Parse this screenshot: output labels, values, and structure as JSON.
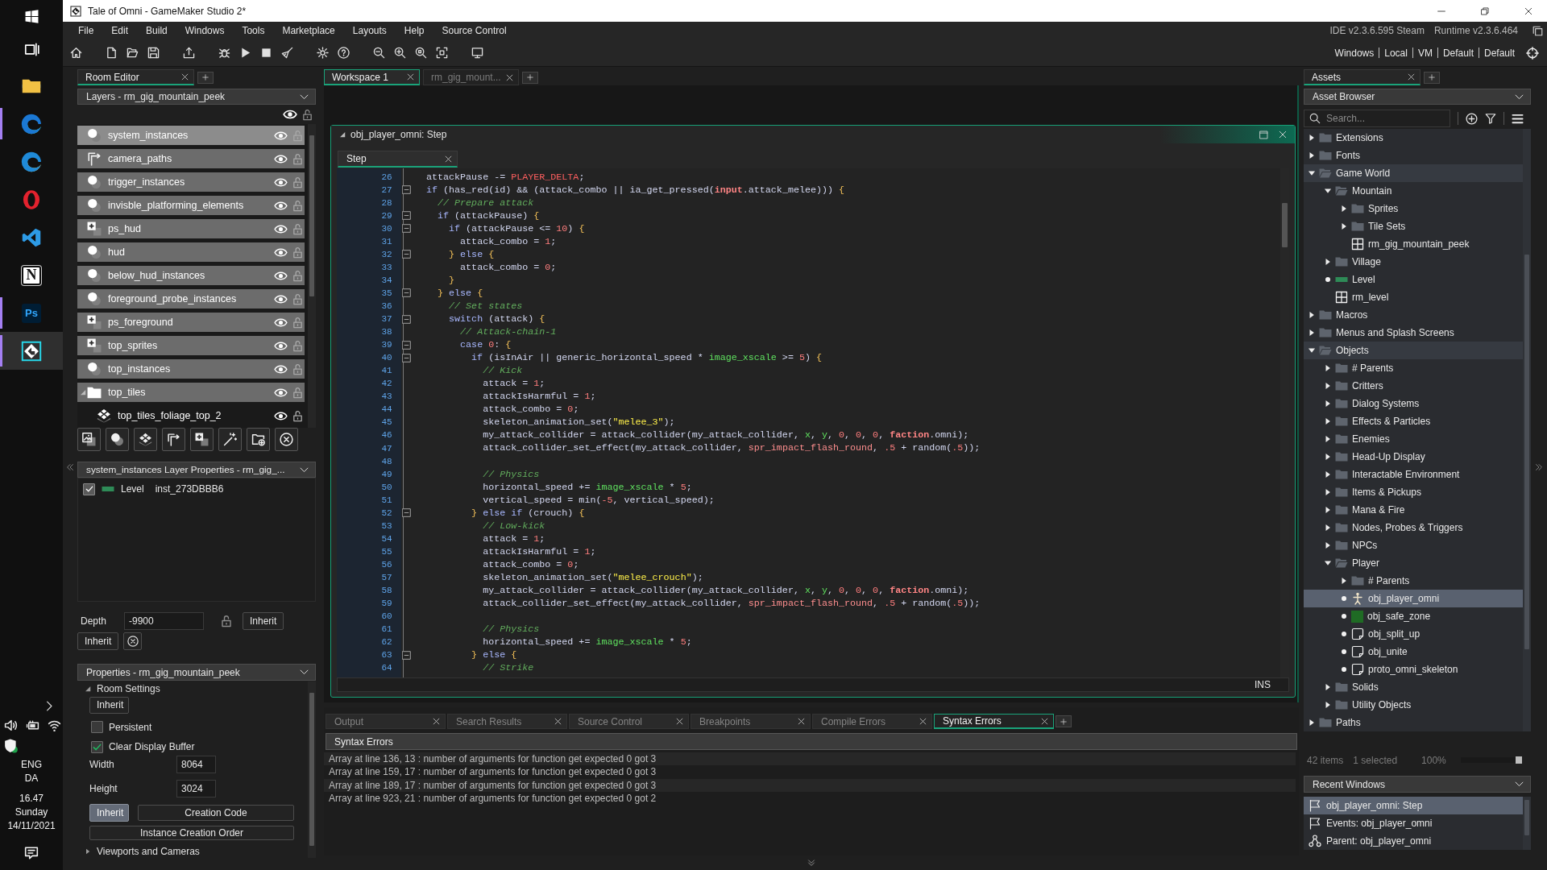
{
  "taskbar": {
    "apps": [
      {
        "kind": "start",
        "running": false,
        "selected": false
      },
      {
        "kind": "task_view",
        "running": false,
        "selected": false
      },
      {
        "kind": "files",
        "running": false,
        "selected": false
      },
      {
        "kind": "browser",
        "running": true,
        "selected": false
      },
      {
        "kind": "browser_beta",
        "running": false,
        "selected": false
      },
      {
        "kind": "ring",
        "running": false,
        "selected": false
      },
      {
        "kind": "editor",
        "running": false,
        "selected": false
      },
      {
        "kind": "notes",
        "label": "N",
        "running": false,
        "selected": false
      },
      {
        "kind": "ps",
        "label": "Ps",
        "running": true,
        "selected": false
      },
      {
        "kind": "gm",
        "running": true,
        "selected": true
      }
    ],
    "tray": {
      "language": [
        "ENG",
        "DA"
      ],
      "time": "16.47",
      "day": "Sunday",
      "date": "14/11/2021"
    }
  },
  "window": {
    "title": "Tale of Omni - GameMaker Studio 2*"
  },
  "menu": {
    "items": [
      "File",
      "Edit",
      "Build",
      "Windows",
      "Tools",
      "Marketplace",
      "Layouts",
      "Help",
      "Source Control"
    ],
    "ide": "IDE v2.3.6.595 Steam",
    "runtime": "Runtime v2.3.6.464"
  },
  "toolbar": {
    "targets": [
      "Windows",
      "Local",
      "VM",
      "Default",
      "Default"
    ]
  },
  "room_editor": {
    "tab": "Room Editor",
    "layers_title": "Layers - rm_gig_mountain_peek",
    "layers": [
      {
        "name": "system_instances",
        "kind": "instance",
        "selected": true
      },
      {
        "name": "camera_paths",
        "kind": "path",
        "selected": false
      },
      {
        "name": "trigger_instances",
        "kind": "instance",
        "selected": false
      },
      {
        "name": "invisble_platforming_elements",
        "kind": "instance",
        "selected": false
      },
      {
        "name": "ps_hud",
        "kind": "asset",
        "selected": false
      },
      {
        "name": "hud",
        "kind": "instance",
        "selected": false
      },
      {
        "name": "below_hud_instances",
        "kind": "instance",
        "selected": false
      },
      {
        "name": "foreground_probe_instances",
        "kind": "instance",
        "selected": false
      },
      {
        "name": "ps_foreground",
        "kind": "asset",
        "selected": false
      },
      {
        "name": "top_sprites",
        "kind": "asset",
        "selected": false
      },
      {
        "name": "top_instances",
        "kind": "instance",
        "selected": false
      },
      {
        "name": "top_tiles",
        "kind": "folder",
        "selected": false,
        "expanded": true,
        "children": [
          {
            "name": "top_tiles_foliage_top_2",
            "kind": "tile",
            "selected": false
          }
        ]
      }
    ],
    "layer_properties": {
      "title": "system_instances Layer Properties - rm_gig_...",
      "instances": [
        {
          "object": "Level",
          "id": "inst_273DBBB6",
          "checked": true
        }
      ],
      "depth": {
        "label": "Depth",
        "value": "-9900",
        "button": "Inherit"
      },
      "inherit_button": "Inherit"
    },
    "properties": {
      "title": "Properties - rm_gig_mountain_peek",
      "room_settings": {
        "label": "Room Settings",
        "expanded": true,
        "inherit_button": "Inherit",
        "options": [
          {
            "label": "Persistent",
            "checked": false
          },
          {
            "label": "Clear Display Buffer",
            "checked": true
          }
        ],
        "fields": [
          {
            "label": "Width",
            "value": "8064"
          },
          {
            "label": "Height",
            "value": "3024"
          }
        ],
        "buttons": [
          {
            "label": "Inherit",
            "selected": true
          },
          {
            "label": "Creation Code",
            "selected": false
          }
        ],
        "order_button": "Instance Creation Order"
      },
      "viewports": {
        "label": "Viewports and Cameras",
        "expanded": false
      }
    }
  },
  "workspace": {
    "tabs": [
      {
        "label": "Workspace 1",
        "selected": true
      },
      {
        "label": "rm_gig_mount...",
        "selected": false
      }
    ],
    "code_window": {
      "title": "obj_player_omni: Step",
      "tab": "Step",
      "mode": "INS",
      "lines": [
        {
          "number": "26",
          "fold": false,
          "tokens": [
            {
              "text": "attackPause -= ",
              "kind": "plain"
            },
            {
              "text": "PLAYER_DELTA",
              "kind": "macro"
            },
            {
              "text": ";",
              "kind": "plain"
            }
          ]
        },
        {
          "number": "27",
          "fold": true,
          "tokens": [
            {
              "text": "if",
              "kind": "keyword"
            },
            {
              "text": " (has_red(id) && (attack_combo || ia_get_pressed(",
              "kind": "plain"
            },
            {
              "text": "input",
              "kind": "enum"
            },
            {
              "text": ".attack_melee))) ",
              "kind": "plain"
            },
            {
              "text": "{",
              "kind": "brace"
            }
          ]
        },
        {
          "number": "28",
          "fold": false,
          "tokens": [
            {
              "text": "  // Prepare attack",
              "kind": "comment"
            }
          ]
        },
        {
          "number": "29",
          "fold": true,
          "tokens": [
            {
              "text": "  if",
              "kind": "keyword"
            },
            {
              "text": " (attackPause) ",
              "kind": "plain"
            },
            {
              "text": "{",
              "kind": "brace"
            }
          ]
        },
        {
          "number": "30",
          "fold": true,
          "tokens": [
            {
              "text": "    if",
              "kind": "keyword"
            },
            {
              "text": " (attackPause <= ",
              "kind": "plain"
            },
            {
              "text": "10",
              "kind": "number"
            },
            {
              "text": ") ",
              "kind": "plain"
            },
            {
              "text": "{",
              "kind": "brace"
            }
          ]
        },
        {
          "number": "31",
          "fold": false,
          "tokens": [
            {
              "text": "      attack_combo = ",
              "kind": "plain"
            },
            {
              "text": "1",
              "kind": "number"
            },
            {
              "text": ";",
              "kind": "plain"
            }
          ]
        },
        {
          "number": "32",
          "fold": true,
          "tokens": [
            {
              "text": "    }",
              "kind": "brace"
            },
            {
              "text": " else",
              "kind": "keyword"
            },
            {
              "text": " {",
              "kind": "brace"
            }
          ]
        },
        {
          "number": "33",
          "fold": false,
          "tokens": [
            {
              "text": "      attack_combo = ",
              "kind": "plain"
            },
            {
              "text": "0",
              "kind": "number"
            },
            {
              "text": ";",
              "kind": "plain"
            }
          ]
        },
        {
          "number": "34",
          "fold": false,
          "tokens": [
            {
              "text": "    }",
              "kind": "brace"
            }
          ]
        },
        {
          "number": "35",
          "fold": true,
          "tokens": [
            {
              "text": "  }",
              "kind": "brace"
            },
            {
              "text": " else",
              "kind": "keyword"
            },
            {
              "text": " {",
              "kind": "brace"
            }
          ]
        },
        {
          "number": "36",
          "fold": false,
          "tokens": [
            {
              "text": "    // Set states",
              "kind": "comment"
            }
          ]
        },
        {
          "number": "37",
          "fold": true,
          "tokens": [
            {
              "text": "    switch",
              "kind": "keyword"
            },
            {
              "text": " (attack) ",
              "kind": "plain"
            },
            {
              "text": "{",
              "kind": "brace"
            }
          ]
        },
        {
          "number": "38",
          "fold": false,
          "tokens": [
            {
              "text": "      // Attack-chain-1",
              "kind": "comment"
            }
          ]
        },
        {
          "number": "39",
          "fold": true,
          "tokens": [
            {
              "text": "      case",
              "kind": "keyword"
            },
            {
              "text": " 0",
              "kind": "number"
            },
            {
              "text": ": ",
              "kind": "plain"
            },
            {
              "text": "{",
              "kind": "brace"
            }
          ]
        },
        {
          "number": "40",
          "fold": true,
          "tokens": [
            {
              "text": "        if",
              "kind": "keyword"
            },
            {
              "text": " (isInAir || generic_horizontal_speed * ",
              "kind": "plain"
            },
            {
              "text": "image_xscale",
              "kind": "builtin"
            },
            {
              "text": " >= ",
              "kind": "plain"
            },
            {
              "text": "5",
              "kind": "number"
            },
            {
              "text": ") ",
              "kind": "plain"
            },
            {
              "text": "{",
              "kind": "brace"
            }
          ]
        },
        {
          "number": "41",
          "fold": false,
          "tokens": [
            {
              "text": "          // Kick",
              "kind": "comment"
            }
          ]
        },
        {
          "number": "42",
          "fold": false,
          "tokens": [
            {
              "text": "          attack = ",
              "kind": "plain"
            },
            {
              "text": "1",
              "kind": "number"
            },
            {
              "text": ";",
              "kind": "plain"
            }
          ]
        },
        {
          "number": "43",
          "fold": false,
          "tokens": [
            {
              "text": "          attackIsHarmful = ",
              "kind": "plain"
            },
            {
              "text": "1",
              "kind": "number"
            },
            {
              "text": ";",
              "kind": "plain"
            }
          ]
        },
        {
          "number": "44",
          "fold": false,
          "tokens": [
            {
              "text": "          attack_combo = ",
              "kind": "plain"
            },
            {
              "text": "0",
              "kind": "number"
            },
            {
              "text": ";",
              "kind": "plain"
            }
          ]
        },
        {
          "number": "45",
          "fold": false,
          "tokens": [
            {
              "text": "          skeleton_animation_set(",
              "kind": "plain"
            },
            {
              "text": "\"melee_3\"",
              "kind": "string"
            },
            {
              "text": ");",
              "kind": "plain"
            }
          ]
        },
        {
          "number": "46",
          "fold": false,
          "tokens": [
            {
              "text": "          my_attack_collider = attack_collider(my_attack_collider, ",
              "kind": "plain"
            },
            {
              "text": "x",
              "kind": "builtin"
            },
            {
              "text": ", ",
              "kind": "plain"
            },
            {
              "text": "y",
              "kind": "builtin"
            },
            {
              "text": ", ",
              "kind": "plain"
            },
            {
              "text": "0",
              "kind": "number"
            },
            {
              "text": ", ",
              "kind": "plain"
            },
            {
              "text": "0",
              "kind": "number"
            },
            {
              "text": ", ",
              "kind": "plain"
            },
            {
              "text": "0",
              "kind": "number"
            },
            {
              "text": ", ",
              "kind": "plain"
            },
            {
              "text": "faction",
              "kind": "enum"
            },
            {
              "text": ".omni);",
              "kind": "plain"
            }
          ]
        },
        {
          "number": "47",
          "fold": false,
          "tokens": [
            {
              "text": "          attack_collider_set_effect(my_attack_collider, ",
              "kind": "plain"
            },
            {
              "text": "spr_impact_flash_round",
              "kind": "asset"
            },
            {
              "text": ", ",
              "kind": "plain"
            },
            {
              "text": ".5",
              "kind": "number"
            },
            {
              "text": " + random(",
              "kind": "plain"
            },
            {
              "text": ".5",
              "kind": "number"
            },
            {
              "text": "));",
              "kind": "plain"
            }
          ]
        },
        {
          "number": "48",
          "fold": false
        },
        {
          "number": "49",
          "fold": false,
          "tokens": [
            {
              "text": "          // Physics",
              "kind": "comment"
            }
          ]
        },
        {
          "number": "50",
          "fold": false,
          "tokens": [
            {
              "text": "          horizontal_speed += ",
              "kind": "plain"
            },
            {
              "text": "image_xscale",
              "kind": "builtin"
            },
            {
              "text": " * ",
              "kind": "plain"
            },
            {
              "text": "5",
              "kind": "number"
            },
            {
              "text": ";",
              "kind": "plain"
            }
          ]
        },
        {
          "number": "51",
          "fold": false,
          "tokens": [
            {
              "text": "          vertical_speed = min(",
              "kind": "plain"
            },
            {
              "text": "-5",
              "kind": "number"
            },
            {
              "text": ", vertical_speed);",
              "kind": "plain"
            }
          ]
        },
        {
          "number": "52",
          "fold": true,
          "tokens": [
            {
              "text": "        }",
              "kind": "brace"
            },
            {
              "text": " else if",
              "kind": "keyword"
            },
            {
              "text": " (crouch) ",
              "kind": "plain"
            },
            {
              "text": "{",
              "kind": "brace"
            }
          ]
        },
        {
          "number": "53",
          "fold": false,
          "tokens": [
            {
              "text": "          // Low-kick",
              "kind": "comment"
            }
          ]
        },
        {
          "number": "54",
          "fold": false,
          "tokens": [
            {
              "text": "          attack = ",
              "kind": "plain"
            },
            {
              "text": "1",
              "kind": "number"
            },
            {
              "text": ";",
              "kind": "plain"
            }
          ]
        },
        {
          "number": "55",
          "fold": false,
          "tokens": [
            {
              "text": "          attackIsHarmful = ",
              "kind": "plain"
            },
            {
              "text": "1",
              "kind": "number"
            },
            {
              "text": ";",
              "kind": "plain"
            }
          ]
        },
        {
          "number": "56",
          "fold": false,
          "tokens": [
            {
              "text": "          attack_combo = ",
              "kind": "plain"
            },
            {
              "text": "0",
              "kind": "number"
            },
            {
              "text": ";",
              "kind": "plain"
            }
          ]
        },
        {
          "number": "57",
          "fold": false,
          "tokens": [
            {
              "text": "          skeleton_animation_set(",
              "kind": "plain"
            },
            {
              "text": "\"melee_crouch\"",
              "kind": "string"
            },
            {
              "text": ");",
              "kind": "plain"
            }
          ]
        },
        {
          "number": "58",
          "fold": false,
          "tokens": [
            {
              "text": "          my_attack_collider = attack_collider(my_attack_collider, ",
              "kind": "plain"
            },
            {
              "text": "x",
              "kind": "builtin"
            },
            {
              "text": ", ",
              "kind": "plain"
            },
            {
              "text": "y",
              "kind": "builtin"
            },
            {
              "text": ", ",
              "kind": "plain"
            },
            {
              "text": "0",
              "kind": "number"
            },
            {
              "text": ", ",
              "kind": "plain"
            },
            {
              "text": "0",
              "kind": "number"
            },
            {
              "text": ", ",
              "kind": "plain"
            },
            {
              "text": "0",
              "kind": "number"
            },
            {
              "text": ", ",
              "kind": "plain"
            },
            {
              "text": "faction",
              "kind": "enum"
            },
            {
              "text": ".omni);",
              "kind": "plain"
            }
          ]
        },
        {
          "number": "59",
          "fold": false,
          "tokens": [
            {
              "text": "          attack_collider_set_effect(my_attack_collider, ",
              "kind": "plain"
            },
            {
              "text": "spr_impact_flash_round",
              "kind": "asset"
            },
            {
              "text": ", ",
              "kind": "plain"
            },
            {
              "text": ".5",
              "kind": "number"
            },
            {
              "text": " + random(",
              "kind": "plain"
            },
            {
              "text": ".5",
              "kind": "number"
            },
            {
              "text": "));",
              "kind": "plain"
            }
          ]
        },
        {
          "number": "60",
          "fold": false
        },
        {
          "number": "61",
          "fold": false,
          "tokens": [
            {
              "text": "          // Physics",
              "kind": "comment"
            }
          ]
        },
        {
          "number": "62",
          "fold": false,
          "tokens": [
            {
              "text": "          horizontal_speed += ",
              "kind": "plain"
            },
            {
              "text": "image_xscale",
              "kind": "builtin"
            },
            {
              "text": " * ",
              "kind": "plain"
            },
            {
              "text": "5",
              "kind": "number"
            },
            {
              "text": ";",
              "kind": "plain"
            }
          ]
        },
        {
          "number": "63",
          "fold": true,
          "tokens": [
            {
              "text": "        }",
              "kind": "brace"
            },
            {
              "text": " else",
              "kind": "keyword"
            },
            {
              "text": " {",
              "kind": "brace"
            }
          ]
        },
        {
          "number": "64",
          "fold": false,
          "tokens": [
            {
              "text": "          // Strike",
              "kind": "comment"
            }
          ]
        }
      ]
    }
  },
  "output": {
    "tabs": [
      {
        "label": "Output",
        "selected": false
      },
      {
        "label": "Search Results",
        "selected": false
      },
      {
        "label": "Source Control",
        "selected": false
      },
      {
        "label": "Breakpoints",
        "selected": false
      },
      {
        "label": "Compile Errors",
        "selected": false
      },
      {
        "label": "Syntax Errors",
        "selected": true
      }
    ],
    "header": "Syntax Errors",
    "messages": [
      "Array at line 136, 13 : number of arguments for function get expected 0 got 3",
      "Array at line 159, 17 : number of arguments for function get expected 0 got 3",
      "Array at line 189, 17 : number of arguments for function get expected 0 got 3",
      "Array at line 923, 21 : number of arguments for function get expected 0 got 2"
    ]
  },
  "assets": {
    "tab": "Assets",
    "browser": "Asset Browser",
    "search": {
      "placeholder": "Search..."
    },
    "tree": [
      {
        "name": "Extensions",
        "kind": "folder",
        "expanded": false,
        "selected": false
      },
      {
        "name": "Fonts",
        "kind": "folder",
        "expanded": false,
        "selected": false
      },
      {
        "name": "Game World",
        "kind": "folder",
        "expanded": true,
        "selected": false,
        "children": [
          {
            "name": "Mountain",
            "kind": "folder",
            "expanded": true,
            "selected": false,
            "children": [
              {
                "name": "Sprites",
                "kind": "folder",
                "expanded": false,
                "selected": false
              },
              {
                "name": "Tile Sets",
                "kind": "folder",
                "expanded": false,
                "selected": false
              },
              {
                "name": "rm_gig_mountain_peek",
                "kind": "room",
                "selected": false
              }
            ]
          },
          {
            "name": "Village",
            "kind": "folder",
            "expanded": false,
            "selected": false
          },
          {
            "name": "Level",
            "kind": "sequence",
            "selected": false
          },
          {
            "name": "rm_level",
            "kind": "room",
            "selected": false
          }
        ]
      },
      {
        "name": "Macros",
        "kind": "folder",
        "expanded": false,
        "selected": false
      },
      {
        "name": "Menus and Splash Screens",
        "kind": "folder",
        "expanded": false,
        "selected": false
      },
      {
        "name": "Objects",
        "kind": "folder",
        "expanded": true,
        "selected": false,
        "children": [
          {
            "name": "# Parents",
            "kind": "folder",
            "expanded": false,
            "selected": false
          },
          {
            "name": "Critters",
            "kind": "folder",
            "expanded": false,
            "selected": false
          },
          {
            "name": "Dialog Systems",
            "kind": "folder",
            "expanded": false,
            "selected": false
          },
          {
            "name": "Effects & Particles",
            "kind": "folder",
            "expanded": false,
            "selected": false
          },
          {
            "name": "Enemies",
            "kind": "folder",
            "expanded": false,
            "selected": false
          },
          {
            "name": "Head-Up Display",
            "kind": "folder",
            "expanded": false,
            "selected": false
          },
          {
            "name": "Interactable Environment",
            "kind": "folder",
            "expanded": false,
            "selected": false
          },
          {
            "name": "Items & Pickups",
            "kind": "folder",
            "expanded": false,
            "selected": false
          },
          {
            "name": "Mana & Fire",
            "kind": "folder",
            "expanded": false,
            "selected": false
          },
          {
            "name": "Nodes, Probes & Triggers",
            "kind": "folder",
            "expanded": false,
            "selected": false
          },
          {
            "name": "NPCs",
            "kind": "folder",
            "expanded": false,
            "selected": false
          },
          {
            "name": "Player",
            "kind": "folder",
            "expanded": true,
            "selected": false,
            "children": [
              {
                "name": "# Parents",
                "kind": "folder",
                "expanded": false,
                "selected": false
              },
              {
                "name": "obj_player_omni",
                "kind": "object",
                "sprite": {
                  "kind": "figure"
                },
                "selected": true
              },
              {
                "name": "obj_safe_zone",
                "kind": "object",
                "sprite": {
                  "kind": "swatch",
                  "color": "#1f6b24"
                },
                "selected": false
              },
              {
                "name": "obj_split_up",
                "kind": "object",
                "sprite": {
                  "kind": "blank"
                },
                "selected": false
              },
              {
                "name": "obj_unite",
                "kind": "object",
                "sprite": {
                  "kind": "blank"
                },
                "selected": false
              },
              {
                "name": "proto_omni_skeleton",
                "kind": "object",
                "sprite": {
                  "kind": "blank"
                },
                "selected": false
              }
            ]
          },
          {
            "name": "Solids",
            "kind": "folder",
            "expanded": false,
            "selected": false
          },
          {
            "name": "Utility Objects",
            "kind": "folder",
            "expanded": false,
            "selected": false
          }
        ]
      },
      {
        "name": "Paths",
        "kind": "folder",
        "expanded": false,
        "selected": false
      }
    ],
    "status": {
      "count": "42 items",
      "selection": "1 selected",
      "zoom": "100%",
      "level": 1
    },
    "recent": {
      "title": "Recent Windows",
      "items": [
        {
          "label": "obj_player_omni: Step",
          "kind": "event",
          "selected": true
        },
        {
          "label": "Events: obj_player_omni",
          "kind": "event",
          "selected": false
        },
        {
          "label": "Parent: obj_player_omni",
          "kind": "parent",
          "selected": false
        }
      ]
    }
  }
}
